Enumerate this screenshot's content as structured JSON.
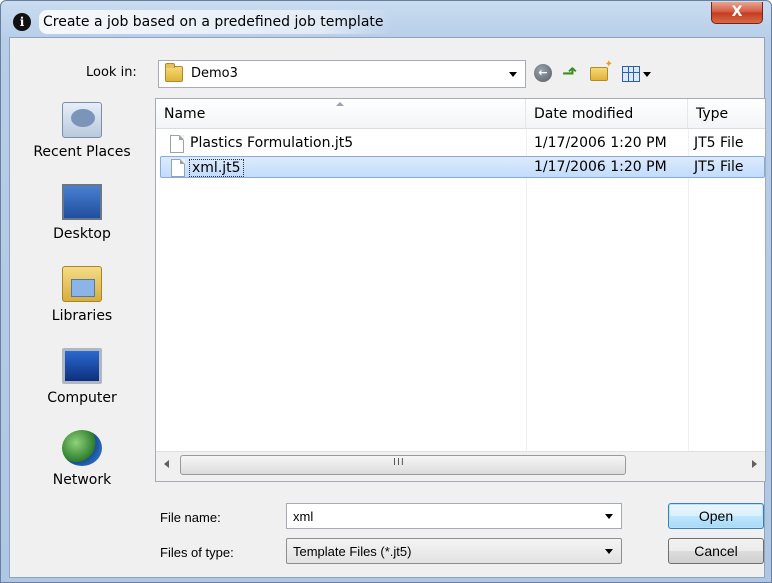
{
  "window": {
    "title": "Create a job based on a predefined job template",
    "close_glyph": "X"
  },
  "toolbar": {
    "look_in_label": "Look in:",
    "look_in_value": "Demo3"
  },
  "places": [
    {
      "label": "Recent Places",
      "icon": "recent-places-icon"
    },
    {
      "label": "Desktop",
      "icon": "desktop-icon"
    },
    {
      "label": "Libraries",
      "icon": "libraries-icon"
    },
    {
      "label": "Computer",
      "icon": "computer-icon"
    },
    {
      "label": "Network",
      "icon": "network-icon"
    }
  ],
  "file_list": {
    "columns": [
      "Name",
      "Date modified",
      "Type"
    ],
    "rows": [
      {
        "name": "Plastics Formulation.jt5",
        "date": "1/17/2006 1:20 PM",
        "type": "JT5 File",
        "selected": false
      },
      {
        "name": "xml.jt5",
        "date": "1/17/2006 1:20 PM",
        "type": "JT5 File",
        "selected": true
      }
    ],
    "scroll_grip": "III"
  },
  "form": {
    "file_name_label": "File name:",
    "file_name_value": "xml",
    "file_type_label": "Files of type:",
    "file_type_value": "Template Files (*.jt5)"
  },
  "buttons": {
    "open": "Open",
    "cancel": "Cancel"
  },
  "colors": {
    "selection": "#c1dcfc",
    "title_bar": "#b7cde8",
    "close_button": "#c33a1f"
  }
}
